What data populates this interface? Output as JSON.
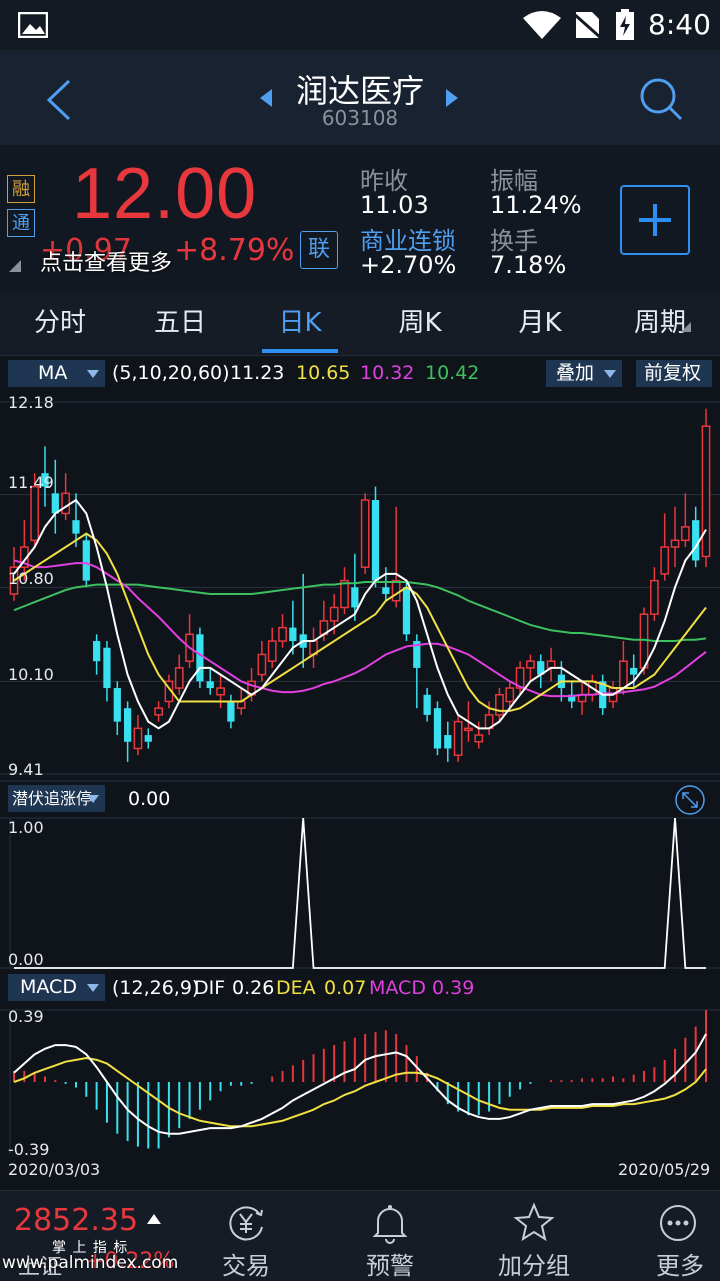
{
  "status": {
    "time": "8:40"
  },
  "header": {
    "stock_name": "润达医疗",
    "stock_code": "603108"
  },
  "quote": {
    "badge_rong": "融",
    "badge_tong": "通",
    "price": "12.00",
    "change": "+0.97",
    "change_pct": "+8.79%",
    "tip": "点击查看更多",
    "lian": "联",
    "prev_close_label": "昨收",
    "prev_close": "11.03",
    "amplitude_label": "振幅",
    "amplitude": "11.24%",
    "sector_label": "商业连锁",
    "sector_change": "+2.70%",
    "turnover_label": "换手",
    "turnover": "7.18%"
  },
  "tabs": [
    "分时",
    "五日",
    "日K",
    "周K",
    "月K",
    "周期"
  ],
  "active_tab": 2,
  "ma": {
    "selector": "MA",
    "params": "(5,10,20,60)",
    "ma5": "11.23",
    "ma10": "10.65",
    "ma20": "10.32",
    "ma60": "10.42",
    "overlay": "叠加",
    "adjust": "前复权"
  },
  "main_axis": {
    "y_labels": [
      "12.18",
      "11.49",
      "10.80",
      "10.10",
      "9.41"
    ]
  },
  "indicator": {
    "selector": "潜伏追涨停",
    "value": "0.00",
    "y_top": "1.00",
    "y_bottom": "0.00"
  },
  "macd": {
    "selector": "MACD",
    "params": "(12,26,9)",
    "dif_label": "DIF",
    "dif": "0.26",
    "dea_label": "DEA",
    "dea": "0.07",
    "macd_label": "MACD",
    "macd": "0.39",
    "y_top": "0.39",
    "y_bottom": "-0.39"
  },
  "dates": {
    "start": "2020/03/03",
    "end": "2020/05/29"
  },
  "colors": {
    "up": "#e8383d",
    "down": "#38e0f0",
    "ma5": "#ffffff",
    "ma10": "#f0e043",
    "ma20": "#e040e0",
    "ma60": "#3cc060",
    "accent": "#2f8ff0"
  },
  "bottom": {
    "index_value": "2852.35",
    "index_change": "+0.22%",
    "index_name": "上证",
    "watermark_top": "掌 上 指 标",
    "watermark": "www.palmindex.com",
    "nav": [
      "交易",
      "预警",
      "加分组",
      "更多"
    ]
  },
  "chart_data": {
    "type": "candlestick",
    "x_start": "2020/03/03",
    "x_end": "2020/05/29",
    "ylim": [
      9.41,
      12.18
    ],
    "candles": [
      [
        10.75,
        10.95,
        10.7,
        11.1
      ],
      [
        10.95,
        11.1,
        10.85,
        11.3
      ],
      [
        11.15,
        11.55,
        11.1,
        11.65
      ],
      [
        11.65,
        11.55,
        11.4,
        11.85
      ],
      [
        11.5,
        11.35,
        11.2,
        11.75
      ],
      [
        11.35,
        11.5,
        11.3,
        11.65
      ],
      [
        11.3,
        11.2,
        11.1,
        11.5
      ],
      [
        11.15,
        10.85,
        10.8,
        11.2
      ],
      [
        10.4,
        10.25,
        10.15,
        10.45
      ],
      [
        10.35,
        10.05,
        9.95,
        10.4
      ],
      [
        10.05,
        9.8,
        9.7,
        10.1
      ],
      [
        9.9,
        9.65,
        9.5,
        9.95
      ],
      [
        9.6,
        9.75,
        9.55,
        9.85
      ],
      [
        9.7,
        9.65,
        9.6,
        9.75
      ],
      [
        9.85,
        9.9,
        9.8,
        9.95
      ],
      [
        9.95,
        10.1,
        9.9,
        10.15
      ],
      [
        10.05,
        10.2,
        10.0,
        10.3
      ],
      [
        10.25,
        10.45,
        10.2,
        10.6
      ],
      [
        10.45,
        10.1,
        10.05,
        10.5
      ],
      [
        10.1,
        10.05,
        10.0,
        10.2
      ],
      [
        10.0,
        10.05,
        9.9,
        10.15
      ],
      [
        9.95,
        9.8,
        9.75,
        10.0
      ],
      [
        9.9,
        9.95,
        9.85,
        10.05
      ],
      [
        10.0,
        10.1,
        9.95,
        10.2
      ],
      [
        10.15,
        10.3,
        10.1,
        10.4
      ],
      [
        10.25,
        10.4,
        10.2,
        10.5
      ],
      [
        10.4,
        10.5,
        10.35,
        10.6
      ],
      [
        10.5,
        10.4,
        10.3,
        10.7
      ],
      [
        10.45,
        10.35,
        10.2,
        10.9
      ],
      [
        10.3,
        10.4,
        10.2,
        10.5
      ],
      [
        10.45,
        10.55,
        10.4,
        10.7
      ],
      [
        10.55,
        10.65,
        10.45,
        10.75
      ],
      [
        10.65,
        10.85,
        10.6,
        10.95
      ],
      [
        10.8,
        10.65,
        10.55,
        11.05
      ],
      [
        10.95,
        11.45,
        10.9,
        11.5
      ],
      [
        11.45,
        10.85,
        10.8,
        11.55
      ],
      [
        10.8,
        10.75,
        10.7,
        10.95
      ],
      [
        10.7,
        10.85,
        10.65,
        11.4
      ],
      [
        10.8,
        10.45,
        10.4,
        10.85
      ],
      [
        10.4,
        10.2,
        9.9,
        10.45
      ],
      [
        10.0,
        9.85,
        9.8,
        10.05
      ],
      [
        9.9,
        9.6,
        9.55,
        9.95
      ],
      [
        9.7,
        9.6,
        9.5,
        9.8
      ],
      [
        9.55,
        9.8,
        9.5,
        9.85
      ],
      [
        9.75,
        9.75,
        9.65,
        9.95
      ],
      [
        9.65,
        9.7,
        9.6,
        9.8
      ],
      [
        9.75,
        9.85,
        9.7,
        9.95
      ],
      [
        9.85,
        10.0,
        9.8,
        10.05
      ],
      [
        9.95,
        10.05,
        9.9,
        10.1
      ],
      [
        10.05,
        10.2,
        10.0,
        10.25
      ],
      [
        10.2,
        10.25,
        10.1,
        10.3
      ],
      [
        10.25,
        10.15,
        10.05,
        10.3
      ],
      [
        10.2,
        10.25,
        10.1,
        10.35
      ],
      [
        10.15,
        10.05,
        9.95,
        10.25
      ],
      [
        10.0,
        9.95,
        9.9,
        10.1
      ],
      [
        9.95,
        10.0,
        9.85,
        10.1
      ],
      [
        10.0,
        10.1,
        9.95,
        10.15
      ],
      [
        10.1,
        9.9,
        9.85,
        10.15
      ],
      [
        9.95,
        10.05,
        9.9,
        10.1
      ],
      [
        10.05,
        10.25,
        10.0,
        10.4
      ],
      [
        10.2,
        10.15,
        10.05,
        10.3
      ],
      [
        10.2,
        10.6,
        10.15,
        10.65
      ],
      [
        10.6,
        10.85,
        10.55,
        10.95
      ],
      [
        10.9,
        11.1,
        10.85,
        11.35
      ],
      [
        11.1,
        11.15,
        10.95,
        11.4
      ],
      [
        11.15,
        11.25,
        11.1,
        11.5
      ],
      [
        11.3,
        11.0,
        10.95,
        11.4
      ],
      [
        11.03,
        12.0,
        10.95,
        12.13
      ]
    ],
    "ma5": [
      10.9,
      11.0,
      11.1,
      11.25,
      11.35,
      11.4,
      11.45,
      11.35,
      11.1,
      10.8,
      10.45,
      10.15,
      9.95,
      9.8,
      9.75,
      9.8,
      9.95,
      10.1,
      10.2,
      10.2,
      10.15,
      10.1,
      10.05,
      10.0,
      10.05,
      10.15,
      10.25,
      10.35,
      10.4,
      10.4,
      10.45,
      10.5,
      10.55,
      10.6,
      10.75,
      10.85,
      10.9,
      10.9,
      10.85,
      10.7,
      10.45,
      10.2,
      10.0,
      9.85,
      9.8,
      9.75,
      9.75,
      9.8,
      9.9,
      10.0,
      10.1,
      10.15,
      10.2,
      10.2,
      10.15,
      10.1,
      10.05,
      10.0,
      10.0,
      10.05,
      10.1,
      10.2,
      10.35,
      10.55,
      10.8,
      11.0,
      11.1,
      11.23
    ],
    "ma10": [
      10.85,
      10.9,
      10.95,
      11.0,
      11.05,
      11.1,
      11.15,
      11.2,
      11.15,
      11.05,
      10.9,
      10.7,
      10.5,
      10.3,
      10.15,
      10.05,
      9.95,
      9.95,
      9.95,
      9.95,
      9.95,
      9.95,
      9.95,
      10.0,
      10.05,
      10.1,
      10.15,
      10.2,
      10.25,
      10.3,
      10.35,
      10.4,
      10.45,
      10.5,
      10.55,
      10.6,
      10.7,
      10.75,
      10.8,
      10.75,
      10.65,
      10.5,
      10.35,
      10.2,
      10.05,
      9.95,
      9.9,
      9.88,
      9.88,
      9.9,
      9.95,
      10.0,
      10.05,
      10.1,
      10.1,
      10.1,
      10.1,
      10.08,
      10.05,
      10.05,
      10.05,
      10.1,
      10.15,
      10.25,
      10.35,
      10.45,
      10.55,
      10.65
    ],
    "ma20": [
      11.0,
      10.98,
      10.95,
      10.95,
      10.96,
      10.97,
      10.98,
      10.98,
      10.95,
      10.9,
      10.85,
      10.8,
      10.72,
      10.65,
      10.58,
      10.5,
      10.42,
      10.35,
      10.3,
      10.25,
      10.2,
      10.15,
      10.1,
      10.07,
      10.05,
      10.03,
      10.02,
      10.02,
      10.03,
      10.05,
      10.08,
      10.1,
      10.13,
      10.16,
      10.2,
      10.25,
      10.3,
      10.33,
      10.36,
      10.37,
      10.38,
      10.38,
      10.36,
      10.33,
      10.3,
      10.25,
      10.2,
      10.15,
      10.1,
      10.06,
      10.03,
      10.0,
      9.99,
      9.99,
      9.99,
      10.0,
      10.0,
      10.01,
      10.01,
      10.02,
      10.03,
      10.04,
      10.06,
      10.1,
      10.14,
      10.2,
      10.26,
      10.32
    ],
    "ma60": [
      10.63,
      10.66,
      10.69,
      10.72,
      10.75,
      10.78,
      10.8,
      10.81,
      10.82,
      10.82,
      10.82,
      10.82,
      10.82,
      10.81,
      10.8,
      10.79,
      10.78,
      10.77,
      10.76,
      10.75,
      10.75,
      10.75,
      10.75,
      10.75,
      10.76,
      10.77,
      10.78,
      10.79,
      10.8,
      10.81,
      10.82,
      10.82,
      10.83,
      10.83,
      10.84,
      10.84,
      10.84,
      10.84,
      10.84,
      10.83,
      10.82,
      10.8,
      10.77,
      10.74,
      10.7,
      10.67,
      10.64,
      10.61,
      10.58,
      10.55,
      10.52,
      10.5,
      10.48,
      10.47,
      10.46,
      10.46,
      10.45,
      10.44,
      10.43,
      10.42,
      10.41,
      10.41,
      10.4,
      10.4,
      10.4,
      10.41,
      10.41,
      10.42
    ],
    "indicator_signal": [
      0,
      0,
      0,
      0,
      0,
      0,
      0,
      0,
      0,
      0,
      0,
      0,
      0,
      0,
      0,
      0,
      0,
      0,
      0,
      0,
      0,
      0,
      0,
      0,
      0,
      0,
      0,
      0,
      0,
      0,
      0,
      0,
      0,
      0,
      0,
      0,
      0,
      0,
      0,
      0,
      0,
      0,
      0,
      0,
      0,
      0,
      0,
      0,
      0,
      0,
      0,
      0,
      0,
      0,
      0,
      0,
      0,
      0,
      0,
      0,
      0,
      0,
      0,
      0,
      0,
      0,
      0,
      0
    ],
    "indicator_spikes": [
      28,
      64
    ],
    "macd_ylim": [
      -0.39,
      0.39
    ],
    "dif": [
      0.05,
      0.1,
      0.15,
      0.18,
      0.2,
      0.2,
      0.19,
      0.15,
      0.08,
      0.0,
      -0.08,
      -0.15,
      -0.2,
      -0.24,
      -0.27,
      -0.28,
      -0.28,
      -0.27,
      -0.26,
      -0.25,
      -0.25,
      -0.25,
      -0.24,
      -0.22,
      -0.2,
      -0.17,
      -0.14,
      -0.1,
      -0.07,
      -0.04,
      -0.01,
      0.02,
      0.05,
      0.07,
      0.12,
      0.14,
      0.15,
      0.16,
      0.14,
      0.08,
      0.02,
      -0.04,
      -0.1,
      -0.14,
      -0.17,
      -0.19,
      -0.2,
      -0.2,
      -0.19,
      -0.17,
      -0.15,
      -0.14,
      -0.13,
      -0.13,
      -0.13,
      -0.13,
      -0.12,
      -0.12,
      -0.12,
      -0.11,
      -0.1,
      -0.08,
      -0.05,
      -0.01,
      0.04,
      0.1,
      0.16,
      0.26
    ],
    "dea": [
      0.0,
      0.02,
      0.05,
      0.07,
      0.09,
      0.11,
      0.12,
      0.13,
      0.12,
      0.1,
      0.06,
      0.02,
      -0.02,
      -0.06,
      -0.1,
      -0.14,
      -0.17,
      -0.19,
      -0.21,
      -0.22,
      -0.23,
      -0.24,
      -0.24,
      -0.24,
      -0.23,
      -0.22,
      -0.21,
      -0.19,
      -0.17,
      -0.15,
      -0.12,
      -0.1,
      -0.07,
      -0.05,
      -0.02,
      0.0,
      0.02,
      0.04,
      0.05,
      0.05,
      0.04,
      0.02,
      -0.01,
      -0.04,
      -0.07,
      -0.1,
      -0.12,
      -0.14,
      -0.15,
      -0.15,
      -0.15,
      -0.15,
      -0.14,
      -0.14,
      -0.14,
      -0.14,
      -0.13,
      -0.13,
      -0.13,
      -0.12,
      -0.12,
      -0.11,
      -0.1,
      -0.09,
      -0.07,
      -0.04,
      0.0,
      0.07
    ],
    "macd_hist": [
      0.06,
      0.06,
      0.05,
      0.03,
      0.01,
      -0.01,
      -0.03,
      -0.08,
      -0.15,
      -0.22,
      -0.28,
      -0.32,
      -0.35,
      -0.36,
      -0.36,
      -0.3,
      -0.25,
      -0.2,
      -0.15,
      -0.1,
      -0.05,
      -0.02,
      -0.02,
      -0.01,
      0.0,
      0.03,
      0.06,
      0.09,
      0.12,
      0.15,
      0.18,
      0.2,
      0.22,
      0.24,
      0.26,
      0.27,
      0.28,
      0.26,
      0.2,
      0.14,
      0.05,
      -0.05,
      -0.12,
      -0.16,
      -0.18,
      -0.18,
      -0.16,
      -0.12,
      -0.08,
      -0.04,
      -0.01,
      0.0,
      0.01,
      0.01,
      0.01,
      0.02,
      0.02,
      0.02,
      0.03,
      0.02,
      0.04,
      0.06,
      0.08,
      0.12,
      0.18,
      0.24,
      0.3,
      0.39
    ]
  }
}
